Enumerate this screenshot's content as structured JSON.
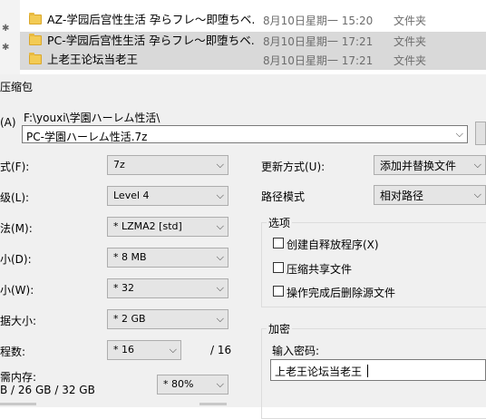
{
  "explorer": {
    "files": [
      {
        "name": "AZ-学园后宫性生活 孕らフレ～即堕ちベ...",
        "date": "8月10日星期一 15:20",
        "type": "文件夹"
      },
      {
        "name": "PC-学园后宫性生活 孕らフレ～即堕ちベ...",
        "date": "8月10日星期一 17:21",
        "type": "文件夹"
      },
      {
        "name": "上老王论坛当老王",
        "date": "8月10日星期一 17:21",
        "type": "文件夹"
      }
    ]
  },
  "dialog": {
    "title": "压缩包",
    "archive_label": "(A)",
    "archive_dir": "F:\\youxi\\学園ハーレム性活\\",
    "archive_name": "PC-学園ハーレム性活.7z",
    "format": {
      "label": "式(F):",
      "value": "7z"
    },
    "level": {
      "label": "级(L):",
      "value": "Level 4"
    },
    "method": {
      "label": "法(M):",
      "value": "* LZMA2 [std]"
    },
    "dict": {
      "label": "小(D):",
      "value": "* 8 MB"
    },
    "word": {
      "label": "小(W):",
      "value": "* 32"
    },
    "solid": {
      "label": "据大小:",
      "value": "* 2 GB"
    },
    "threads": {
      "label": "程数:",
      "value": "* 16",
      "max": "/ 16"
    },
    "memory": {
      "label": "需内存:",
      "values": "B / 26 GB / 32 GB",
      "percent": "* 80%"
    },
    "update_mode": {
      "label": "更新方式(U):",
      "value": "添加并替换文件"
    },
    "path_mode": {
      "label": "路径模式",
      "value": "相对路径"
    },
    "options": {
      "title": "选项",
      "items": [
        "创建自释放程序(X)",
        "压缩共享文件",
        "操作完成后删除源文件"
      ]
    },
    "encryption": {
      "title": "加密",
      "password_label": "输入密码:",
      "password_value": "上老王论坛当老王"
    }
  }
}
